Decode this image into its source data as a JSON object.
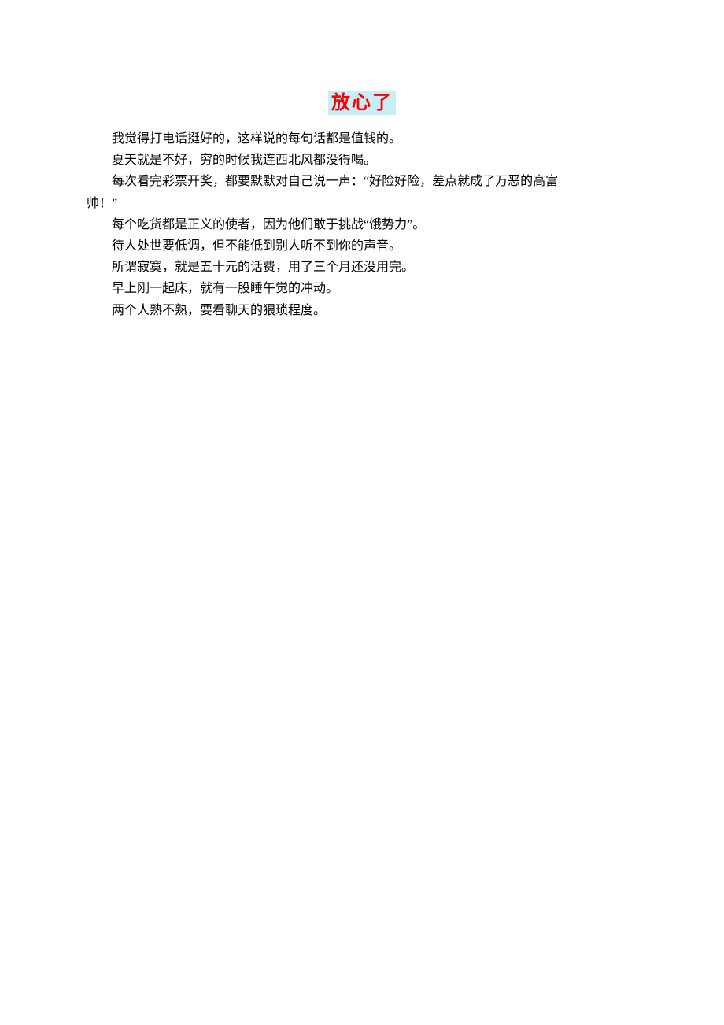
{
  "title": "放心了",
  "paragraphs": [
    {
      "text": "我觉得打电话挺好的，这样说的每句话都是值钱的。",
      "indent": true
    },
    {
      "text": "夏天就是不好，穷的时候我连西北风都没得喝。",
      "indent": true
    },
    {
      "text": "每次看完彩票开奖，都要默默对自己说一声：“好险好险，差点就成了万恶的高富",
      "indent": true
    },
    {
      "text": "帅！”",
      "indent": false
    },
    {
      "text": "每个吃货都是正义的使者，因为他们敢于挑战“饿势力”。",
      "indent": true
    },
    {
      "text": "待人处世要低调，但不能低到别人听不到你的声音。",
      "indent": true
    },
    {
      "text": "所谓寂寞，就是五十元的话费，用了三个月还没用完。",
      "indent": true
    },
    {
      "text": "早上刚一起床，就有一股睡午觉的冲动。",
      "indent": true
    },
    {
      "text": "两个人熟不熟，要看聊天的猥琐程度。",
      "indent": true
    }
  ]
}
